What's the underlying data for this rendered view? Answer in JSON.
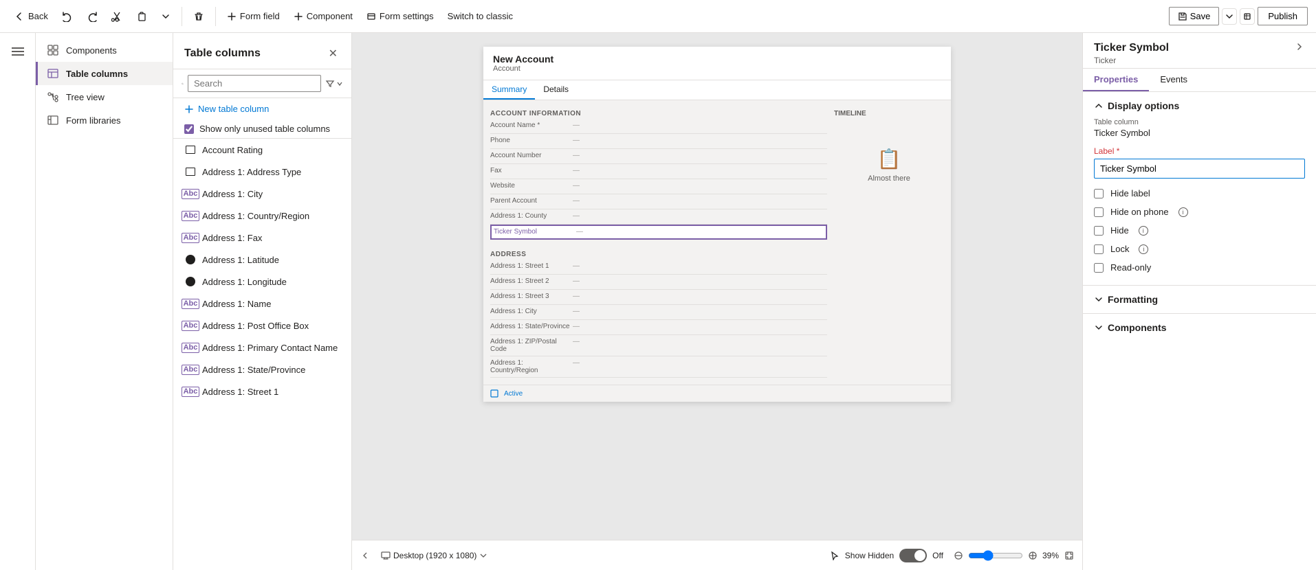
{
  "toolbar": {
    "back_label": "Back",
    "form_field_label": "Form field",
    "component_label": "Component",
    "form_settings_label": "Form settings",
    "switch_classic_label": "Switch to classic",
    "save_label": "Save",
    "publish_label": "Publish"
  },
  "nav": {
    "items": [
      {
        "id": "components",
        "label": "Components",
        "icon": "grid-icon"
      },
      {
        "id": "table-columns",
        "label": "Table columns",
        "icon": "table-icon",
        "active": true
      },
      {
        "id": "tree-view",
        "label": "Tree view",
        "icon": "tree-icon"
      },
      {
        "id": "form-libraries",
        "label": "Form libraries",
        "icon": "library-icon"
      }
    ]
  },
  "table_columns_panel": {
    "title": "Table columns",
    "search_placeholder": "Search",
    "new_column_label": "New table column",
    "show_unused_label": "Show only unused table columns",
    "columns": [
      {
        "id": "account-rating",
        "label": "Account Rating",
        "type": "select"
      },
      {
        "id": "address-type",
        "label": "Address 1: Address Type",
        "type": "select"
      },
      {
        "id": "address-city",
        "label": "Address 1: City",
        "type": "text"
      },
      {
        "id": "address-country",
        "label": "Address 1: Country/Region",
        "type": "text"
      },
      {
        "id": "address-fax",
        "label": "Address 1: Fax",
        "type": "text",
        "has_more": true
      },
      {
        "id": "address-latitude",
        "label": "Address 1: Latitude",
        "type": "circle"
      },
      {
        "id": "address-longitude",
        "label": "Address 1: Longitude",
        "type": "circle"
      },
      {
        "id": "address-name",
        "label": "Address 1: Name",
        "type": "text"
      },
      {
        "id": "address-po-box",
        "label": "Address 1: Post Office Box",
        "type": "text"
      },
      {
        "id": "address-primary-contact",
        "label": "Address 1: Primary Contact Name",
        "type": "text"
      },
      {
        "id": "address-state",
        "label": "Address 1: State/Province",
        "type": "text"
      },
      {
        "id": "address-street1",
        "label": "Address 1: Street 1",
        "type": "text"
      }
    ]
  },
  "form_preview": {
    "title": "New Account",
    "subtitle": "Account",
    "tabs": [
      "Summary",
      "Details"
    ],
    "active_tab": "Summary",
    "section_title": "ACCOUNT INFORMATION",
    "rows": [
      {
        "label": "Account Name",
        "required": true
      },
      {
        "label": "Phone"
      },
      {
        "label": "Account Number"
      },
      {
        "label": "Fax"
      },
      {
        "label": "Website"
      },
      {
        "label": "Parent Account"
      },
      {
        "label": "Address 1: County"
      },
      {
        "label": "Ticker Symbol",
        "highlighted": true
      }
    ],
    "address_section": "ADDRESS",
    "address_rows": [
      {
        "label": "Address 1: Street 1"
      },
      {
        "label": "Address 1: Street 2"
      },
      {
        "label": "Address 1: Street 3"
      },
      {
        "label": "Address 1: City"
      },
      {
        "label": "Address 1: State/Province"
      },
      {
        "label": "Address 1: ZIP/Postal Code"
      },
      {
        "label": "Address 1: Country/Region"
      }
    ],
    "timeline_title": "Timeline",
    "almost_there_text": "Almost there",
    "status_label": "Active"
  },
  "right_panel": {
    "title": "Ticker Symbol",
    "subtitle": "Ticker",
    "tabs": [
      "Properties",
      "Events"
    ],
    "active_tab": "Properties",
    "display_options_title": "Display options",
    "table_column_label": "Table column",
    "table_column_value": "Ticker Symbol",
    "label_field_label": "Label",
    "label_required": true,
    "label_value": "Ticker Symbol",
    "checkboxes": [
      {
        "id": "hide-label",
        "label": "Hide label",
        "checked": false
      },
      {
        "id": "hide-on-phone",
        "label": "Hide on phone",
        "checked": false,
        "has_info": true
      },
      {
        "id": "hide",
        "label": "Hide",
        "checked": false,
        "has_info": true
      },
      {
        "id": "lock",
        "label": "Lock",
        "checked": false,
        "has_info": true
      },
      {
        "id": "read-only",
        "label": "Read-only",
        "checked": false
      }
    ],
    "formatting_title": "Formatting",
    "components_title": "Components"
  },
  "canvas_bottom": {
    "desktop_label": "Desktop (1920 x 1080)",
    "show_hidden_label": "Show Hidden",
    "toggle_state": "Off",
    "zoom_level": "39%"
  }
}
